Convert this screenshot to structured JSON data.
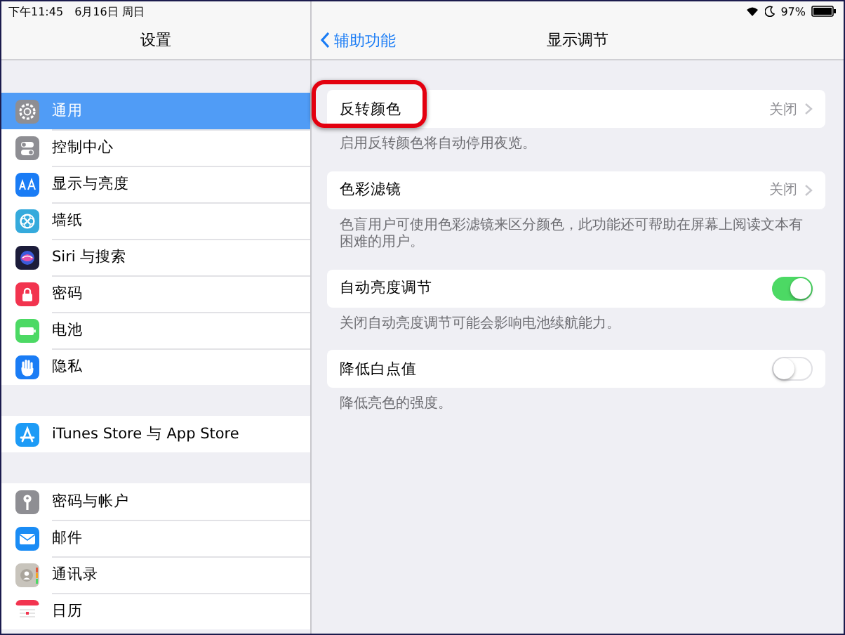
{
  "status_bar": {
    "time": "下午11:45",
    "date": "6月16日 周日",
    "battery": "97%"
  },
  "sidebar": {
    "title": "设置",
    "groups": [
      {
        "items": [
          {
            "label": "通用",
            "selected": true,
            "color": "#8e8e93"
          },
          {
            "label": "控制中心",
            "selected": false,
            "color": "#8e8e93"
          },
          {
            "label": "显示与亮度",
            "selected": false,
            "color": "#1a7cf5"
          },
          {
            "label": "墙纸",
            "selected": false,
            "color": "#35aadc"
          },
          {
            "label": "Siri 与搜索",
            "selected": false,
            "color": "#1c1c3a"
          },
          {
            "label": "密码",
            "selected": false,
            "color": "#f2344f"
          },
          {
            "label": "电池",
            "selected": false,
            "color": "#4cd964"
          },
          {
            "label": "隐私",
            "selected": false,
            "color": "#1a7cf5"
          }
        ]
      },
      {
        "items": [
          {
            "label": "iTunes Store 与 App Store",
            "selected": false,
            "color": "#1d9bf6"
          }
        ]
      },
      {
        "items": [
          {
            "label": "密码与帐户",
            "selected": false,
            "color": "#8e8e93"
          },
          {
            "label": "邮件",
            "selected": false,
            "color": "#1a8cf5"
          },
          {
            "label": "通讯录",
            "selected": false,
            "color": "#c8c4bc"
          },
          {
            "label": "日历",
            "selected": false,
            "color": "#ffffff"
          }
        ]
      }
    ]
  },
  "detail": {
    "back": "辅助功能",
    "title": "显示调节",
    "rows": [
      {
        "kind": "link",
        "label": "反转颜色",
        "value": "关闭",
        "highlighted": true,
        "note": "启用反转颜色将自动停用夜览。"
      },
      {
        "kind": "link",
        "label": "色彩滤镜",
        "value": "关闭",
        "highlighted": false,
        "note": "色盲用户可使用色彩滤镜来区分颜色，此功能还可帮助在屏幕上阅读文本有困难的用户。"
      },
      {
        "kind": "switch",
        "label": "自动亮度调节",
        "on": true,
        "note": "关闭自动亮度调节可能会影响电池续航能力。"
      },
      {
        "kind": "switch",
        "label": "降低白点值",
        "on": false,
        "note": "降低亮色的强度。"
      }
    ]
  }
}
